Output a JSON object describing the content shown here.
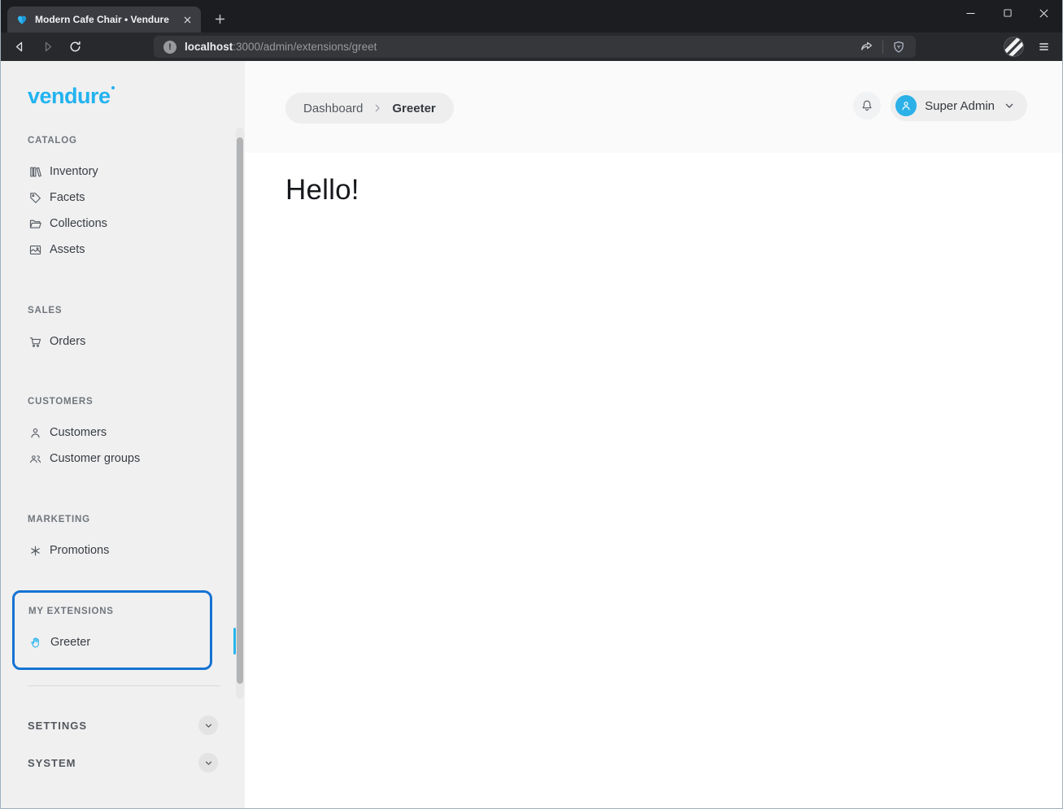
{
  "window": {
    "tab_title": "Modern Cafe Chair • Vendure",
    "url_host": "localhost",
    "url_rest": ":3000/admin/extensions/greet"
  },
  "sidebar": {
    "logo": "vendure",
    "sections": [
      {
        "label": "CATALOG",
        "items": [
          {
            "label": "Inventory"
          },
          {
            "label": "Facets"
          },
          {
            "label": "Collections"
          },
          {
            "label": "Assets"
          }
        ]
      },
      {
        "label": "SALES",
        "items": [
          {
            "label": "Orders"
          }
        ]
      },
      {
        "label": "CUSTOMERS",
        "items": [
          {
            "label": "Customers"
          },
          {
            "label": "Customer groups"
          }
        ]
      },
      {
        "label": "MARKETING",
        "items": [
          {
            "label": "Promotions"
          }
        ]
      }
    ],
    "extensions": {
      "label": "MY EXTENSIONS",
      "item": "Greeter"
    },
    "collapsed": [
      {
        "label": "SETTINGS"
      },
      {
        "label": "SYSTEM"
      }
    ]
  },
  "header": {
    "breadcrumb": {
      "root": "Dashboard",
      "current": "Greeter"
    },
    "user_name": "Super Admin"
  },
  "content": {
    "greeting": "Hello!"
  },
  "colors": {
    "accent": "#29b4ec",
    "logo": "#22b3ef",
    "extension_border": "#1573d2",
    "avatar": "#2bb0e8"
  }
}
